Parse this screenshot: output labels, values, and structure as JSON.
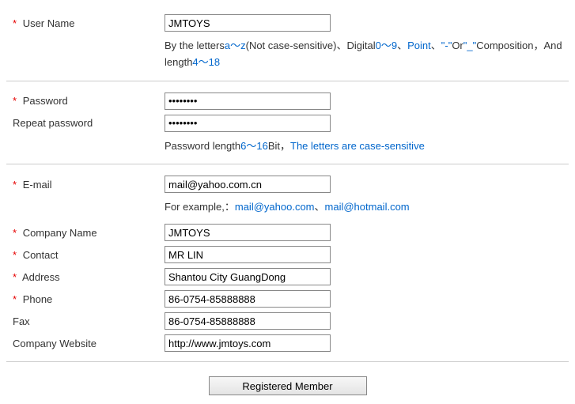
{
  "labels": {
    "username": "User Name",
    "password": "Password",
    "repeat_password": "Repeat password",
    "email": "E-mail",
    "company_name": "Company Name",
    "contact": "Contact",
    "address": "Address",
    "phone": "Phone",
    "fax": "Fax",
    "website": "Company Website"
  },
  "values": {
    "username": "JMTOYS",
    "password": "••••••••",
    "repeat_password": "••••••••",
    "email": "mail@yahoo.com.cn",
    "company_name": "JMTOYS",
    "contact": "MR LIN",
    "address": "Shantou City GuangDong",
    "phone": "86-0754-85888888",
    "fax": "86-0754-85888888",
    "website": "http://www.jmtoys.com"
  },
  "hints": {
    "user_a": "By the letters",
    "user_b": "a～z",
    "user_c": "(Not case-sensitive)、Digital",
    "user_d": "0～9",
    "user_e": "、",
    "user_f": "Point",
    "user_g": "、",
    "user_h": "\"-\"",
    "user_i": "Or",
    "user_j": "\"_\"",
    "user_k": "Composition，And length",
    "user_l": "4～18",
    "pass_a": "Password length",
    "pass_b": "6～16",
    "pass_c": "Bit，",
    "pass_d": "The letters are case-sensitive",
    "email_a": "For example,：",
    "email_b": "mail@yahoo.com",
    "email_c": "、",
    "email_d": "mail@hotmail.com"
  },
  "submit_label": "Registered Member"
}
